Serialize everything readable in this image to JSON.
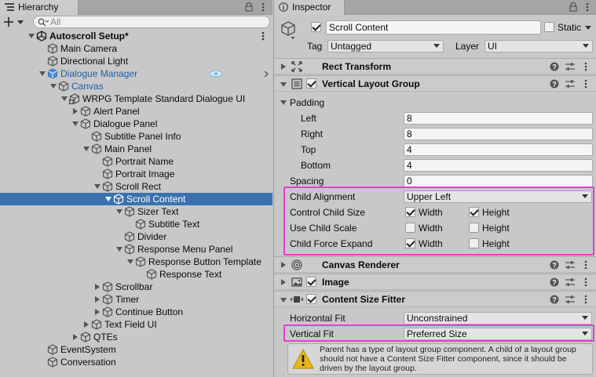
{
  "hierarchy": {
    "tab_label": "Hierarchy",
    "search_placeholder": "All",
    "rows": [
      {
        "label": "Autoscroll Setup*",
        "depth": 0,
        "expand": "open",
        "icon": "unity",
        "bold": true,
        "kebab": true
      },
      {
        "label": "Main Camera",
        "depth": 1,
        "expand": "none",
        "icon": "cube"
      },
      {
        "label": "Directional Light",
        "depth": 1,
        "expand": "none",
        "icon": "cube"
      },
      {
        "label": "Dialogue Manager",
        "depth": 1,
        "expand": "open",
        "icon": "cube-blue",
        "blue": true,
        "chevron": true
      },
      {
        "label": "Canvas",
        "depth": 2,
        "expand": "open",
        "icon": "cube",
        "blue": true
      },
      {
        "label": "WRPG Template Standard Dialogue UI",
        "depth": 3,
        "expand": "open",
        "icon": "cube-plus"
      },
      {
        "label": "Alert Panel",
        "depth": 4,
        "expand": "closed",
        "icon": "cube"
      },
      {
        "label": "Dialogue Panel",
        "depth": 4,
        "expand": "open",
        "icon": "cube"
      },
      {
        "label": "Subtitle Panel Info",
        "depth": 5,
        "expand": "none",
        "icon": "cube"
      },
      {
        "label": "Main Panel",
        "depth": 5,
        "expand": "open",
        "icon": "cube"
      },
      {
        "label": "Portrait Name",
        "depth": 6,
        "expand": "none",
        "icon": "cube"
      },
      {
        "label": "Portrait Image",
        "depth": 6,
        "expand": "none",
        "icon": "cube"
      },
      {
        "label": "Scroll Rect",
        "depth": 6,
        "expand": "open",
        "icon": "cube"
      },
      {
        "label": "Scroll Content",
        "depth": 7,
        "expand": "open",
        "icon": "cube",
        "selected": true
      },
      {
        "label": "Sizer Text",
        "depth": 8,
        "expand": "open",
        "icon": "cube"
      },
      {
        "label": "Subtitle Text",
        "depth": 9,
        "expand": "none",
        "icon": "cube"
      },
      {
        "label": "Divider",
        "depth": 8,
        "expand": "none",
        "icon": "cube"
      },
      {
        "label": "Response Menu Panel",
        "depth": 8,
        "expand": "open",
        "icon": "cube"
      },
      {
        "label": "Response Button Template",
        "depth": 9,
        "expand": "open",
        "icon": "cube"
      },
      {
        "label": "Response Text",
        "depth": 10,
        "expand": "none",
        "icon": "cube"
      },
      {
        "label": "Scrollbar",
        "depth": 6,
        "expand": "closed",
        "icon": "cube"
      },
      {
        "label": "Timer",
        "depth": 6,
        "expand": "closed",
        "icon": "cube"
      },
      {
        "label": "Continue Button",
        "depth": 6,
        "expand": "closed",
        "icon": "cube"
      },
      {
        "label": "Text Field UI",
        "depth": 5,
        "expand": "closed",
        "icon": "cube"
      },
      {
        "label": "QTEs",
        "depth": 4,
        "expand": "closed",
        "icon": "cube"
      },
      {
        "label": "EventSystem",
        "depth": 1,
        "expand": "none",
        "icon": "cube"
      },
      {
        "label": "Conversation",
        "depth": 1,
        "expand": "none",
        "icon": "cube"
      }
    ]
  },
  "inspector": {
    "tab_label": "Inspector",
    "object_name": "Scroll Content",
    "static_label": "Static",
    "tag_label": "Tag",
    "tag_value": "Untagged",
    "layer_label": "Layer",
    "layer_value": "UI",
    "rect_transform": {
      "title": "Rect Transform"
    },
    "vlg": {
      "title": "Vertical Layout Group",
      "padding_label": "Padding",
      "left_label": "Left",
      "left_value": "8",
      "right_label": "Right",
      "right_value": "8",
      "top_label": "Top",
      "top_value": "4",
      "bottom_label": "Bottom",
      "bottom_value": "4",
      "spacing_label": "Spacing",
      "spacing_value": "0",
      "child_alignment_label": "Child Alignment",
      "child_alignment_value": "Upper Left",
      "control_child_size_label": "Control Child Size",
      "use_child_scale_label": "Use Child Scale",
      "child_force_expand_label": "Child Force Expand",
      "width_label": "Width",
      "height_label": "Height",
      "control_width": true,
      "control_height": true,
      "scale_width": false,
      "scale_height": false,
      "expand_width": true,
      "expand_height": false
    },
    "canvas_renderer": {
      "title": "Canvas Renderer"
    },
    "image": {
      "title": "Image"
    },
    "csf": {
      "title": "Content Size Fitter",
      "horizontal_label": "Horizontal Fit",
      "horizontal_value": "Unconstrained",
      "vertical_label": "Vertical Fit",
      "vertical_value": "Preferred Size",
      "warning_line1": "Parent has a type of layout group component. A child of a layout group",
      "warning_line2": "should not have a Content Size Fitter component, since it should be",
      "warning_line3": "driven by the layout group."
    },
    "highlight_color": "#e23fd0"
  }
}
